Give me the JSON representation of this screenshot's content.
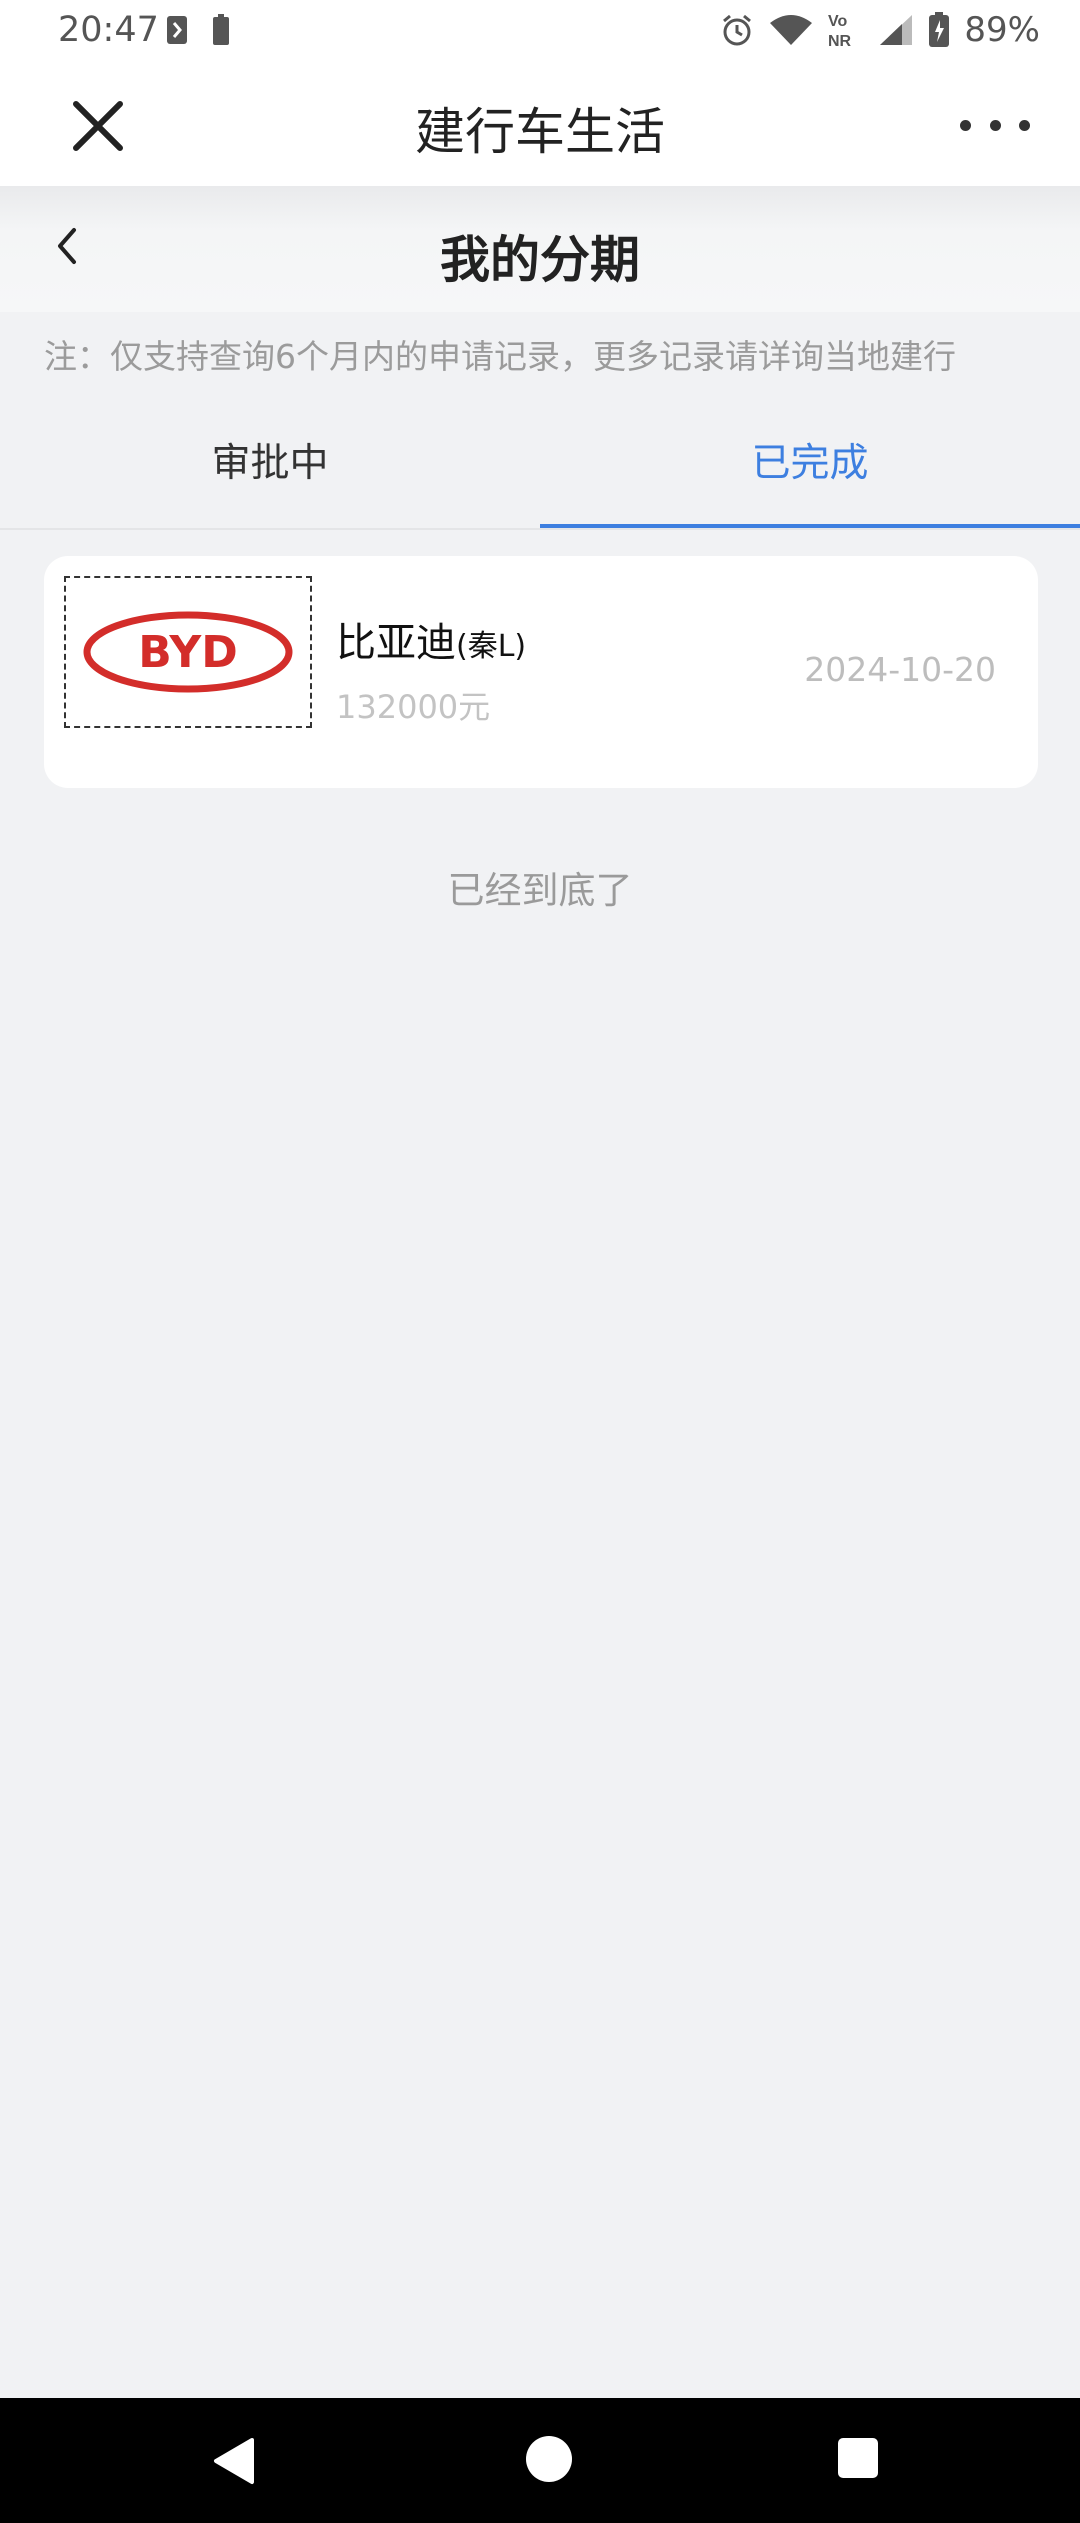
{
  "status_bar": {
    "time": "20:47",
    "battery": "89%",
    "icons": [
      "notification-icon",
      "battery-small-icon",
      "alarm-icon",
      "wifi-icon",
      "volte-nr-icon",
      "signal-icon",
      "battery-icon"
    ]
  },
  "app_header": {
    "title": "建行车生活",
    "close_icon": "close-icon",
    "more_icon": "more-icon"
  },
  "page": {
    "title": "我的分期",
    "note": "注：仅支持查询6个月内的申请记录，更多记录请详询当地建行"
  },
  "tabs": [
    {
      "label": "审批中",
      "active": false
    },
    {
      "label": "已完成",
      "active": true
    }
  ],
  "records": [
    {
      "logo_text": "BYD",
      "brand": "比亚迪",
      "model": "(秦L)",
      "price": "132000元",
      "date": "2024-10-20"
    }
  ],
  "end_text": "已经到底了",
  "colors": {
    "accent": "#3d7fe0",
    "background": "#f1f2f4",
    "byd_red": "#d32d2a"
  }
}
